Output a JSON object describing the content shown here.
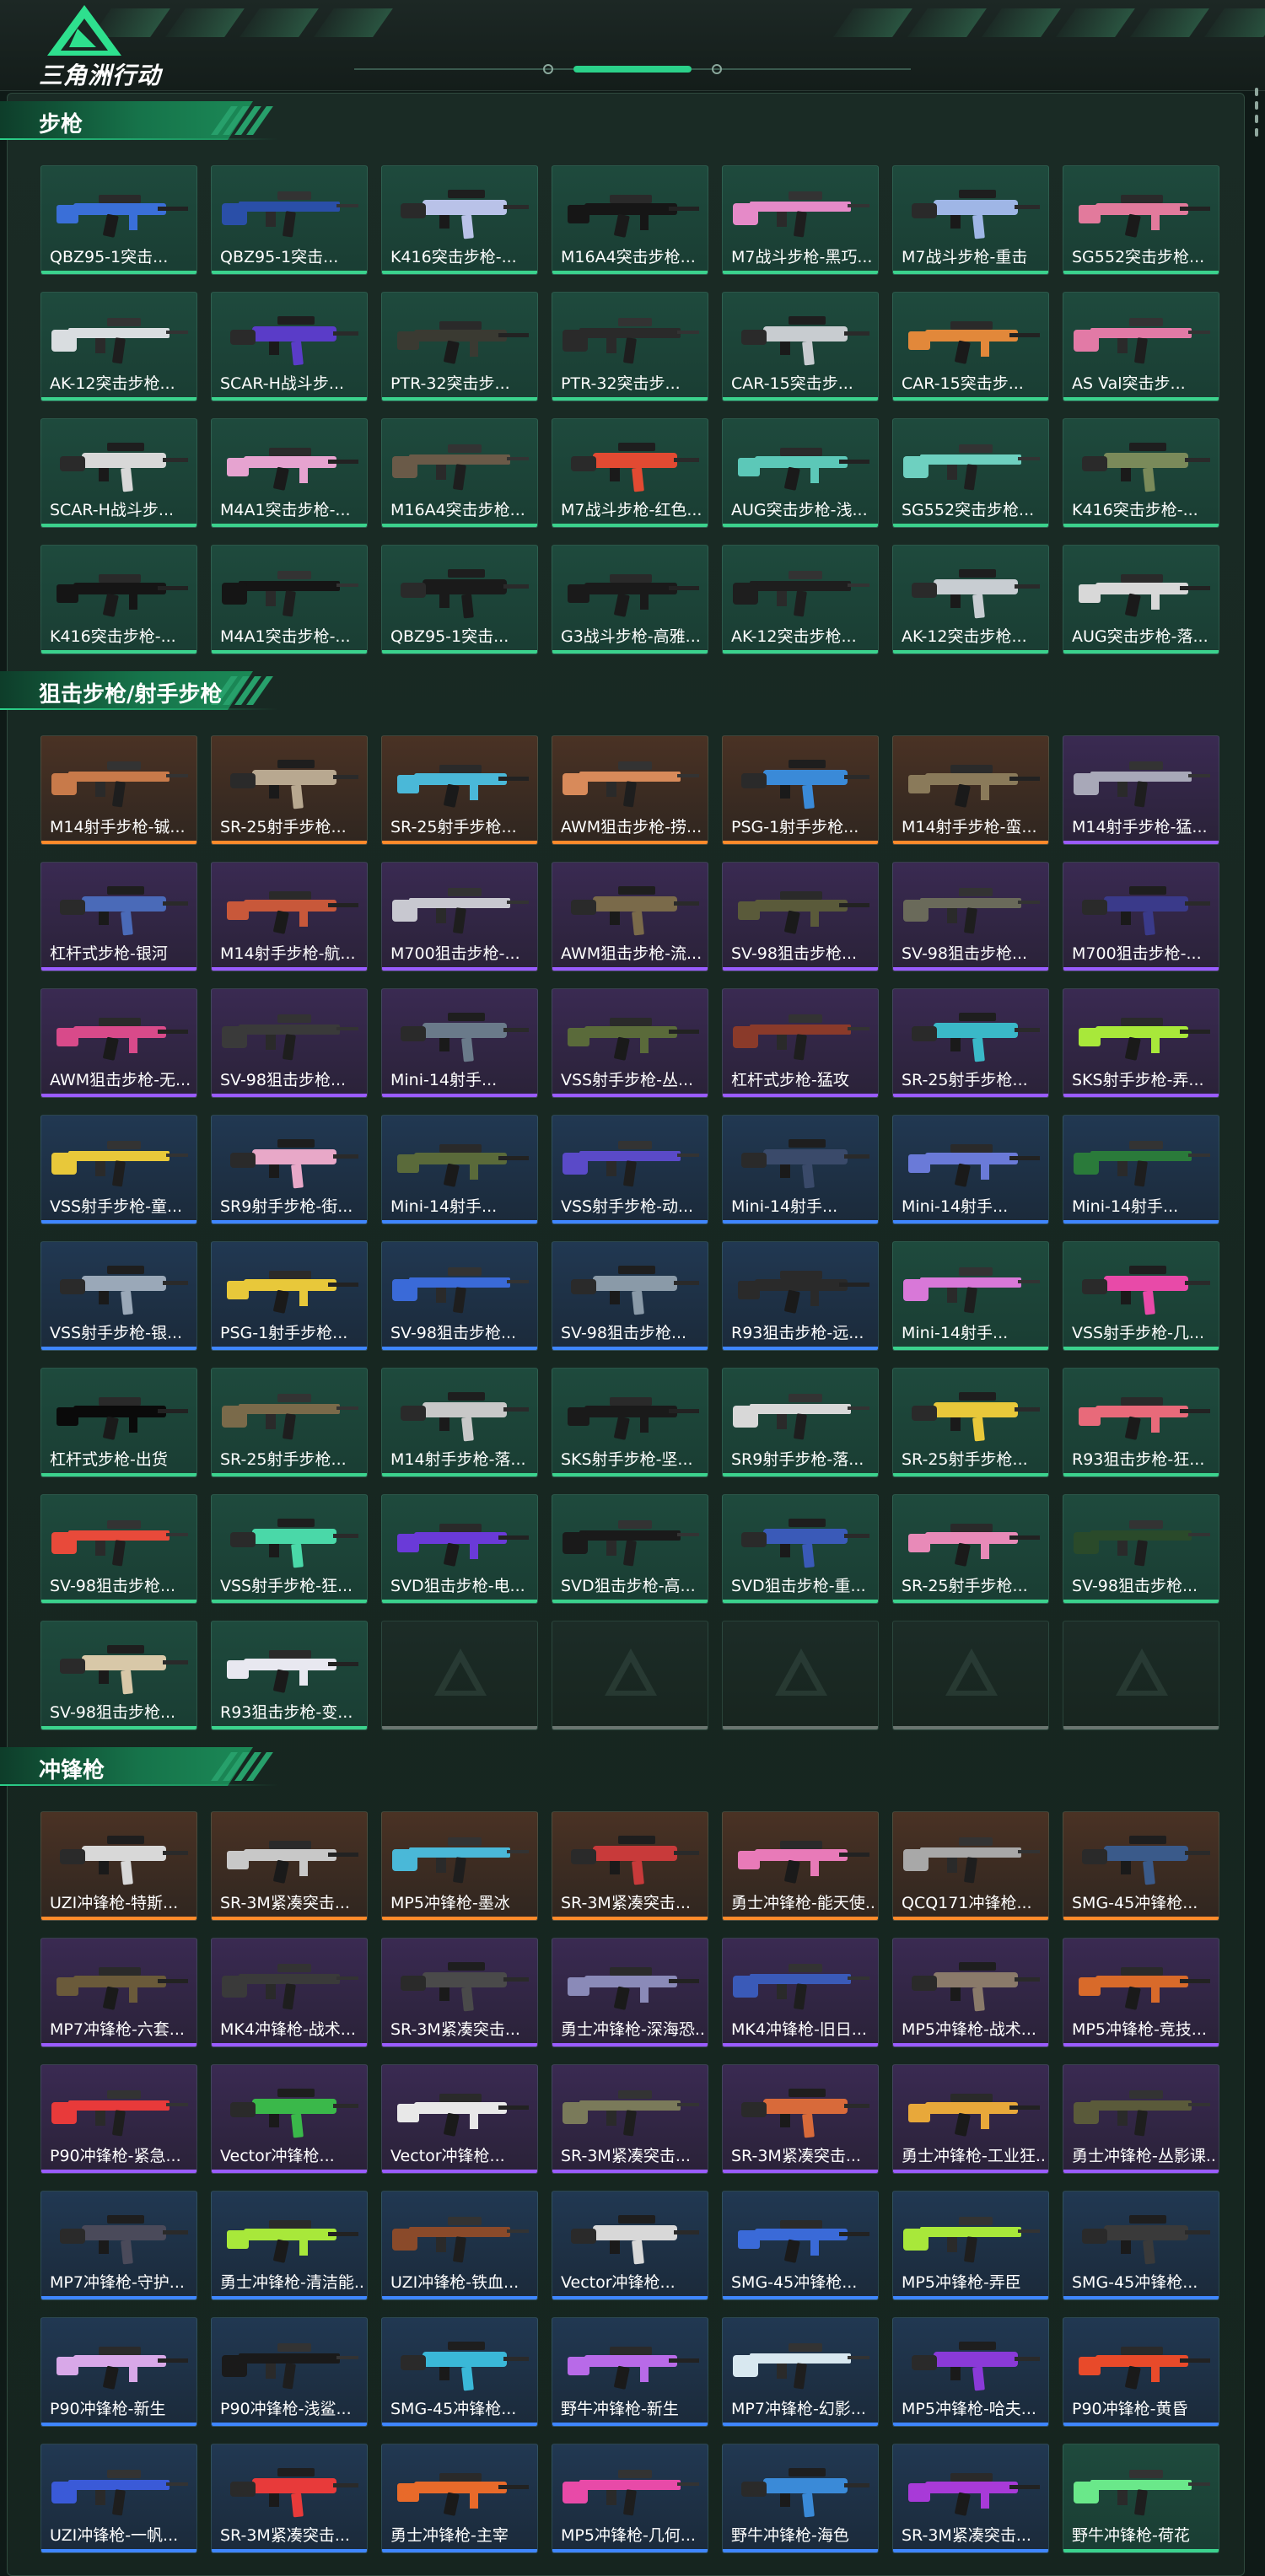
{
  "app": {
    "logo_text": "三角洲行动",
    "logo_icon": "delta-triangle-icon",
    "accent": "#3bd28d"
  },
  "rarity_colors": {
    "green": "#3bd28d",
    "orange": "#ff8a2b",
    "purple": "#9a5cff",
    "blue": "#3f86ff"
  },
  "sections": [
    {
      "title": "步枪",
      "items": [
        {
          "name": "QBZ95-1突击...",
          "rarity": "green",
          "tint": "#3a6fd8"
        },
        {
          "name": "QBZ95-1突击...",
          "rarity": "green",
          "tint": "#2a4fa8"
        },
        {
          "name": "K416突击步枪-...",
          "rarity": "green",
          "tint": "#b9c2e8"
        },
        {
          "name": "M16A4突击步枪...",
          "rarity": "green",
          "tint": "#161616"
        },
        {
          "name": "M7战斗步枪-黑巧...",
          "rarity": "green",
          "tint": "#e58ac8"
        },
        {
          "name": "M7战斗步枪-重击",
          "rarity": "green",
          "tint": "#9fb6e6"
        },
        {
          "name": "SG552突击步枪...",
          "rarity": "green",
          "tint": "#e27a9c"
        },
        {
          "name": "AK-12突击步枪...",
          "rarity": "green",
          "tint": "#d9dde0"
        },
        {
          "name": "SCAR-H战斗步...",
          "rarity": "green",
          "tint": "#5a3cc8"
        },
        {
          "name": "PTR-32突击步...",
          "rarity": "green",
          "tint": "#3a3a32"
        },
        {
          "name": "PTR-32突击步...",
          "rarity": "green",
          "tint": "#2a2a2a"
        },
        {
          "name": "CAR-15突击步...",
          "rarity": "green",
          "tint": "#c8ccd0"
        },
        {
          "name": "CAR-15突击步...",
          "rarity": "green",
          "tint": "#e2883a"
        },
        {
          "name": "AS Val突击步...",
          "rarity": "green",
          "tint": "#e27aa6"
        },
        {
          "name": "SCAR-H战斗步...",
          "rarity": "green",
          "tint": "#d8d8d8"
        },
        {
          "name": "M4A1突击步枪-...",
          "rarity": "green",
          "tint": "#e6a3d0"
        },
        {
          "name": "M16A4突击步枪...",
          "rarity": "green",
          "tint": "#6a5a48"
        },
        {
          "name": "M7战斗步枪-红色...",
          "rarity": "green",
          "tint": "#e24a32"
        },
        {
          "name": "AUG突击步枪-浅...",
          "rarity": "green",
          "tint": "#5cc8b8"
        },
        {
          "name": "SG552突击步枪...",
          "rarity": "green",
          "tint": "#6ed0c0"
        },
        {
          "name": "K416突击步枪-...",
          "rarity": "green",
          "tint": "#7a8a5a"
        },
        {
          "name": "K416突击步枪-...",
          "rarity": "green",
          "tint": "#151515"
        },
        {
          "name": "M4A1突击步枪-...",
          "rarity": "green",
          "tint": "#151515"
        },
        {
          "name": "QBZ95-1突击...",
          "rarity": "green",
          "tint": "#1a1a1a"
        },
        {
          "name": "G3战斗步枪-高雅...",
          "rarity": "green",
          "tint": "#1a1a1a"
        },
        {
          "name": "AK-12突击步枪...",
          "rarity": "green",
          "tint": "#1e1e1e"
        },
        {
          "name": "AK-12突击步枪...",
          "rarity": "green",
          "tint": "#c8cdd2"
        },
        {
          "name": "AUG突击步枪-落...",
          "rarity": "green",
          "tint": "#d8d8d8"
        }
      ]
    },
    {
      "title": "狙击步枪/射手步枪",
      "items": [
        {
          "name": "M14射手步枪-铖...",
          "rarity": "orange",
          "tint": "#c87a4a"
        },
        {
          "name": "SR-25射手步枪...",
          "rarity": "orange",
          "tint": "#b8a890"
        },
        {
          "name": "SR-25射手步枪...",
          "rarity": "orange",
          "tint": "#4ab8d8"
        },
        {
          "name": "AWM狙击步枪-捞...",
          "rarity": "orange",
          "tint": "#d88a5a"
        },
        {
          "name": "PSG-1射手步枪...",
          "rarity": "orange",
          "tint": "#3a8ad8"
        },
        {
          "name": "M14射手步枪-蛮...",
          "rarity": "orange",
          "tint": "#8a7a5a"
        },
        {
          "name": "M14射手步枪-猛...",
          "rarity": "purple",
          "tint": "#a8a8b8"
        },
        {
          "name": "杠杆式步枪-银河",
          "rarity": "purple",
          "tint": "#4a6ab8"
        },
        {
          "name": "M14射手步枪-航...",
          "rarity": "purple",
          "tint": "#c8583a"
        },
        {
          "name": "M700狙击步枪-...",
          "rarity": "purple",
          "tint": "#c8c8d0"
        },
        {
          "name": "AWM狙击步枪-流...",
          "rarity": "purple",
          "tint": "#7a6a4a"
        },
        {
          "name": "SV-98狙击步枪...",
          "rarity": "purple",
          "tint": "#5a5a3a"
        },
        {
          "name": "SV-98狙击步枪...",
          "rarity": "purple",
          "tint": "#6a6a5a"
        },
        {
          "name": "M700狙击步枪-...",
          "rarity": "purple",
          "tint": "#3a3a8a"
        },
        {
          "name": "AWM狙击步枪-无...",
          "rarity": "purple",
          "tint": "#d84a8a"
        },
        {
          "name": "SV-98狙击步枪...",
          "rarity": "purple",
          "tint": "#3a3a3a"
        },
        {
          "name": "Mini-14射手...",
          "rarity": "purple",
          "tint": "#6a7a8a"
        },
        {
          "name": "VSS射手步枪-丛...",
          "rarity": "purple",
          "tint": "#5a6a3a"
        },
        {
          "name": "杠杆式步枪-猛攻",
          "rarity": "purple",
          "tint": "#8a3a2a"
        },
        {
          "name": "SR-25射手步枪...",
          "rarity": "purple",
          "tint": "#3ab8c8"
        },
        {
          "name": "SKS射手步枪-弄...",
          "rarity": "purple",
          "tint": "#a8e83a"
        },
        {
          "name": "VSS射手步枪-童...",
          "rarity": "blue",
          "tint": "#e8c83a"
        },
        {
          "name": "SR9射手步枪-街...",
          "rarity": "blue",
          "tint": "#e8a8c8"
        },
        {
          "name": "Mini-14射手...",
          "rarity": "blue",
          "tint": "#5a6a3a"
        },
        {
          "name": "VSS射手步枪-动...",
          "rarity": "blue",
          "tint": "#5a4ac8"
        },
        {
          "name": "Mini-14射手...",
          "rarity": "blue",
          "tint": "#3a4a6a"
        },
        {
          "name": "Mini-14射手...",
          "rarity": "blue",
          "tint": "#6a7ad8"
        },
        {
          "name": "Mini-14射手...",
          "rarity": "blue",
          "tint": "#2a7a3a"
        },
        {
          "name": "VSS射手步枪-银...",
          "rarity": "blue",
          "tint": "#9aa8b8"
        },
        {
          "name": "PSG-1射手步枪...",
          "rarity": "blue",
          "tint": "#e8c83a"
        },
        {
          "name": "SV-98狙击步枪...",
          "rarity": "blue",
          "tint": "#3a6ad8"
        },
        {
          "name": "SV-98狙击步枪...",
          "rarity": "blue",
          "tint": "#8a9aa8"
        },
        {
          "name": "R93狙击步枪-远...",
          "rarity": "blue",
          "tint": "#2a2a2a"
        },
        {
          "name": "Mini-14射手...",
          "rarity": "green",
          "tint": "#d878d8"
        },
        {
          "name": "VSS射手步枪-几...",
          "rarity": "green",
          "tint": "#e84aa8"
        },
        {
          "name": "杠杆式步枪-出货",
          "rarity": "green",
          "tint": "#0a0a0a"
        },
        {
          "name": "SR-25射手步枪...",
          "rarity": "green",
          "tint": "#7a6a4a"
        },
        {
          "name": "M14射手步枪-落...",
          "rarity": "green",
          "tint": "#c8c8c8"
        },
        {
          "name": "SKS射手步枪-坚...",
          "rarity": "green",
          "tint": "#1a1a1a"
        },
        {
          "name": "SR9射手步枪-落...",
          "rarity": "green",
          "tint": "#d8d8d8"
        },
        {
          "name": "SR-25射手步枪...",
          "rarity": "green",
          "tint": "#e8c83a"
        },
        {
          "name": "R93狙击步枪-狂...",
          "rarity": "green",
          "tint": "#e86a7a"
        },
        {
          "name": "SV-98狙击步枪...",
          "rarity": "green",
          "tint": "#e84a3a"
        },
        {
          "name": "VSS射手步枪-狂...",
          "rarity": "green",
          "tint": "#4ad8a8"
        },
        {
          "name": "SVD狙击步枪-电...",
          "rarity": "green",
          "tint": "#6a3ad8"
        },
        {
          "name": "SVD狙击步枪-高...",
          "rarity": "green",
          "tint": "#1a1a1a"
        },
        {
          "name": "SVD狙击步枪-重...",
          "rarity": "green",
          "tint": "#3a5ab8"
        },
        {
          "name": "SR-25射手步枪...",
          "rarity": "green",
          "tint": "#e88ab8"
        },
        {
          "name": "SV-98狙击步枪...",
          "rarity": "green",
          "tint": "#2a4a2a"
        },
        {
          "name": "SV-98狙击步枪...",
          "rarity": "green",
          "tint": "#d8c8a8"
        },
        {
          "name": "R93狙击步枪-变...",
          "rarity": "green",
          "tint": "#e8e8f0"
        },
        {
          "name": "",
          "rarity": "empty",
          "tint": ""
        },
        {
          "name": "",
          "rarity": "empty",
          "tint": ""
        },
        {
          "name": "",
          "rarity": "empty",
          "tint": ""
        },
        {
          "name": "",
          "rarity": "empty",
          "tint": ""
        },
        {
          "name": "",
          "rarity": "empty",
          "tint": ""
        }
      ]
    },
    {
      "title": "冲锋枪",
      "items": [
        {
          "name": "UZI冲锋枪-特斯...",
          "rarity": "orange",
          "tint": "#d8d8d8"
        },
        {
          "name": "SR-3M紧凑突击...",
          "rarity": "orange",
          "tint": "#c8c8c8"
        },
        {
          "name": "MP5冲锋枪-墨冰",
          "rarity": "orange",
          "tint": "#4ab8d8"
        },
        {
          "name": "SR-3M紧凑突击...",
          "rarity": "orange",
          "tint": "#c83a3a"
        },
        {
          "name": "勇士冲锋枪-能天使...",
          "rarity": "orange",
          "tint": "#e87ab8"
        },
        {
          "name": "QCQ171冲锋枪...",
          "rarity": "orange",
          "tint": "#a8a8a8"
        },
        {
          "name": "SMG-45冲锋枪...",
          "rarity": "orange",
          "tint": "#3a5a8a"
        },
        {
          "name": "MP7冲锋枪-六套...",
          "rarity": "purple",
          "tint": "#6a5a3a"
        },
        {
          "name": "MK4冲锋枪-战术...",
          "rarity": "purple",
          "tint": "#3a3a3a"
        },
        {
          "name": "SR-3M紧凑突击...",
          "rarity": "purple",
          "tint": "#4a4a4a"
        },
        {
          "name": "勇士冲锋枪-深海恐...",
          "rarity": "purple",
          "tint": "#8a8ab8"
        },
        {
          "name": "MK4冲锋枪-旧日...",
          "rarity": "purple",
          "tint": "#3a5ab8"
        },
        {
          "name": "MP5冲锋枪-战术...",
          "rarity": "purple",
          "tint": "#8a7a6a"
        },
        {
          "name": "MP5冲锋枪-竞技...",
          "rarity": "purple",
          "tint": "#d86a2a"
        },
        {
          "name": "P90冲锋枪-紧急...",
          "rarity": "purple",
          "tint": "#e83a3a"
        },
        {
          "name": "Vector冲锋枪...",
          "rarity": "purple",
          "tint": "#3ab84a"
        },
        {
          "name": "Vector冲锋枪...",
          "rarity": "purple",
          "tint": "#e8e8e8"
        },
        {
          "name": "SR-3M紧凑突击...",
          "rarity": "purple",
          "tint": "#7a7a5a"
        },
        {
          "name": "SR-3M紧凑突击...",
          "rarity": "purple",
          "tint": "#d86a3a"
        },
        {
          "name": "勇士冲锋枪-工业狂...",
          "rarity": "purple",
          "tint": "#e8a83a"
        },
        {
          "name": "勇士冲锋枪-丛影课...",
          "rarity": "purple",
          "tint": "#5a5a3a"
        },
        {
          "name": "MP7冲锋枪-守护...",
          "rarity": "blue",
          "tint": "#4a4a5a"
        },
        {
          "name": "勇士冲锋枪-清洁能...",
          "rarity": "blue",
          "tint": "#a8e83a"
        },
        {
          "name": "UZI冲锋枪-铁血...",
          "rarity": "blue",
          "tint": "#8a4a2a"
        },
        {
          "name": "Vector冲锋枪...",
          "rarity": "blue",
          "tint": "#d8d8d8"
        },
        {
          "name": "SMG-45冲锋枪...",
          "rarity": "blue",
          "tint": "#3a6ad8"
        },
        {
          "name": "MP5冲锋枪-弄臣",
          "rarity": "blue",
          "tint": "#a8e83a"
        },
        {
          "name": "SMG-45冲锋枪...",
          "rarity": "blue",
          "tint": "#3a3a3a"
        },
        {
          "name": "P90冲锋枪-新生",
          "rarity": "blue",
          "tint": "#d8a8e8"
        },
        {
          "name": "P90冲锋枪-浅鲨...",
          "rarity": "blue",
          "tint": "#1a1a1a"
        },
        {
          "name": "SMG-45冲锋枪...",
          "rarity": "blue",
          "tint": "#3ab8d8"
        },
        {
          "name": "野牛冲锋枪-新生",
          "rarity": "blue",
          "tint": "#b86ae8"
        },
        {
          "name": "MP7冲锋枪-幻影...",
          "rarity": "blue",
          "tint": "#d8e8f0"
        },
        {
          "name": "MP5冲锋枪-哈夫...",
          "rarity": "blue",
          "tint": "#8a3ad8"
        },
        {
          "name": "P90冲锋枪-黄昏",
          "rarity": "blue",
          "tint": "#e84a2a"
        },
        {
          "name": "UZI冲锋枪-一帆...",
          "rarity": "blue",
          "tint": "#3a5ad8"
        },
        {
          "name": "SR-3M紧凑突击...",
          "rarity": "blue",
          "tint": "#e83a3a"
        },
        {
          "name": "勇士冲锋枪-主宰",
          "rarity": "blue",
          "tint": "#e86a2a"
        },
        {
          "name": "MP5冲锋枪-几何...",
          "rarity": "blue",
          "tint": "#e84aa8"
        },
        {
          "name": "野牛冲锋枪-海色",
          "rarity": "blue",
          "tint": "#3a8ad8"
        },
        {
          "name": "SR-3M紧凑突击...",
          "rarity": "blue",
          "tint": "#a83ad8"
        },
        {
          "name": "野牛冲锋枪-荷花",
          "rarity": "green",
          "tint": "#6ae88a"
        }
      ]
    }
  ]
}
